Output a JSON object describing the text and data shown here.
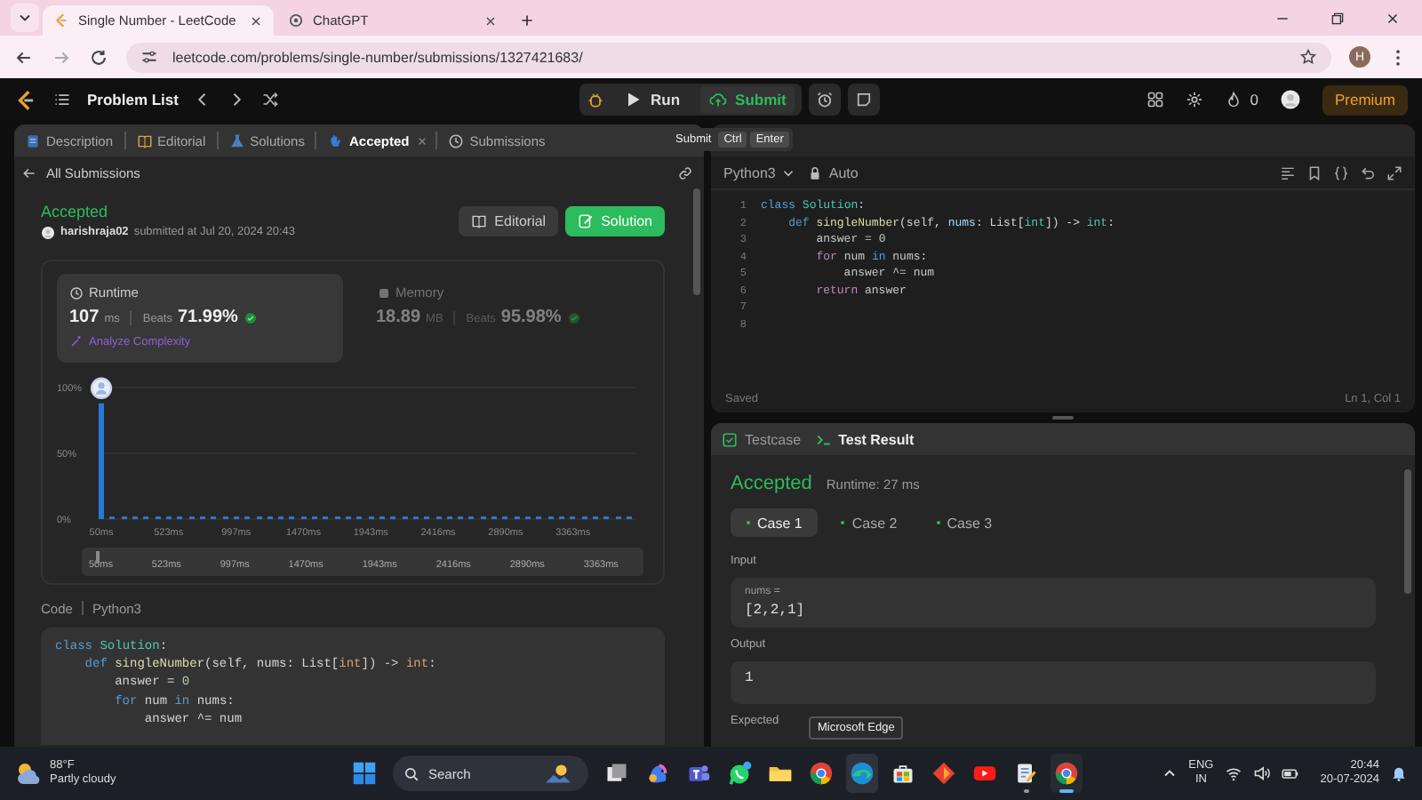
{
  "browser": {
    "tabs": [
      {
        "title": "Single Number - LeetCode",
        "selected": true
      },
      {
        "title": "ChatGPT",
        "selected": false
      }
    ],
    "url": "leetcode.com/problems/single-number/submissions/1327421683/",
    "profile_initial": "H"
  },
  "nav": {
    "problem_list": "Problem List",
    "run": "Run",
    "submit": "Submit",
    "streak": "0",
    "premium": "Premium"
  },
  "submit_tooltip": {
    "label": "Submit",
    "keys": [
      "Ctrl",
      "Enter"
    ]
  },
  "left_tabs": [
    {
      "label": "Description",
      "selected": false,
      "closable": false
    },
    {
      "label": "Editorial",
      "selected": false,
      "closable": false
    },
    {
      "label": "Solutions",
      "selected": false,
      "closable": false
    },
    {
      "label": "Accepted",
      "selected": true,
      "closable": true
    },
    {
      "label": "Submissions",
      "selected": false,
      "closable": false
    }
  ],
  "back_link": "All Submissions",
  "submission": {
    "status": "Accepted",
    "user": "harishraja02",
    "submitted": "submitted at Jul 20, 2024 20:43",
    "buttons": [
      {
        "label": "Editorial",
        "kind": "secondary"
      },
      {
        "label": "Solution",
        "kind": "primary"
      }
    ]
  },
  "metrics": [
    {
      "title": "Runtime",
      "value": "107",
      "unit": "ms",
      "beats_label": "Beats",
      "beats": "71.99%",
      "selected": true,
      "link": "Analyze Complexity"
    },
    {
      "title": "Memory",
      "value": "18.89",
      "unit": "MB",
      "beats_label": "Beats",
      "beats": "95.98%",
      "selected": false
    }
  ],
  "distribution": {
    "chart_data": {
      "type": "bar",
      "ylim": [
        0,
        100
      ],
      "xlim": [
        50,
        3758
      ],
      "yticks": [
        {
          "value": 0,
          "label": "0%"
        },
        {
          "value": 50,
          "label": "50%"
        },
        {
          "value": 100,
          "label": "100%"
        }
      ],
      "xticks": [
        {
          "value": 50,
          "label": "50ms"
        },
        {
          "value": 523,
          "label": "523ms"
        },
        {
          "value": 997,
          "label": "997ms"
        },
        {
          "value": 1470,
          "label": "1470ms"
        },
        {
          "value": 1943,
          "label": "1943ms"
        },
        {
          "value": 2416,
          "label": "2416ms"
        },
        {
          "value": 2890,
          "label": "2890ms"
        },
        {
          "value": 3363,
          "label": "3363ms"
        }
      ],
      "x": [
        50,
        129,
        208,
        287,
        366,
        445,
        523,
        602,
        681,
        760,
        839,
        918,
        997,
        1076,
        1155,
        1234,
        1312,
        1391,
        1470,
        1549,
        1628,
        1707,
        1786,
        1865,
        1943,
        2022,
        2101,
        2180,
        2259,
        2338,
        2416,
        2495,
        2574,
        2653,
        2732,
        2811,
        2890,
        2969,
        3048,
        3127,
        3206,
        3285,
        3363,
        3442,
        3521,
        3600,
        3679,
        3758
      ],
      "values": [
        88,
        2,
        2,
        2,
        2,
        2,
        2,
        2,
        2,
        2,
        2,
        2,
        2,
        2,
        2,
        2,
        2,
        2,
        2,
        2,
        2,
        2,
        2,
        2,
        2,
        2,
        2,
        2,
        2,
        2,
        2,
        2,
        2,
        2,
        2,
        2,
        2,
        2,
        2,
        2,
        2,
        2,
        2,
        2,
        2,
        2,
        2,
        2
      ]
    },
    "navigator_labels": [
      "50ms",
      "523ms",
      "997ms",
      "1470ms",
      "1943ms",
      "2416ms",
      "2890ms",
      "3363ms"
    ]
  },
  "code_view": {
    "label": "Code",
    "language": "Python3",
    "lines": [
      {
        "segments": [
          {
            "text": "class",
            "kind": "keyword"
          },
          {
            "text": " Solution",
            "kind": "class"
          },
          {
            "text": ":",
            "kind": "plain"
          }
        ]
      },
      {
        "segments": [
          {
            "text": "    def",
            "kind": "keyword"
          },
          {
            "text": " singleNumber",
            "kind": "function"
          },
          {
            "text": "(self, nums: List[",
            "kind": "plain"
          },
          {
            "text": "int",
            "kind": "type"
          },
          {
            "text": "]) -> ",
            "kind": "plain"
          },
          {
            "text": "int",
            "kind": "type"
          },
          {
            "text": ":",
            "kind": "plain"
          }
        ]
      },
      {
        "segments": [
          {
            "text": "        answer = ",
            "kind": "plain"
          },
          {
            "text": "0",
            "kind": "number"
          }
        ]
      },
      {
        "segments": [
          {
            "text": "        for",
            "kind": "keyword"
          },
          {
            "text": " num ",
            "kind": "plain"
          },
          {
            "text": "in",
            "kind": "keyword"
          },
          {
            "text": " nums:",
            "kind": "plain"
          }
        ]
      },
      {
        "segments": [
          {
            "text": "            answer ^= num",
            "kind": "plain"
          }
        ]
      }
    ]
  },
  "editor": {
    "language": "Python3",
    "mode": "Auto",
    "status": "Saved",
    "cursor": "Ln 1, Col 1",
    "lines": [
      {
        "number": "1",
        "segments": [
          {
            "text": "class",
            "kind": "keyword"
          },
          {
            "text": " Solution",
            "kind": "class"
          },
          {
            "text": ":",
            "kind": "plain"
          }
        ]
      },
      {
        "number": "2",
        "segments": [
          {
            "text": "    def",
            "kind": "keyword"
          },
          {
            "text": " singleNumber",
            "kind": "function"
          },
          {
            "text": "(self, ",
            "kind": "plain"
          },
          {
            "text": "nums",
            "kind": "param"
          },
          {
            "text": ": List[",
            "kind": "plain"
          },
          {
            "text": "int",
            "kind": "type"
          },
          {
            "text": "]) -> ",
            "kind": "plain"
          },
          {
            "text": "int",
            "kind": "type"
          },
          {
            "text": ":",
            "kind": "plain"
          }
        ]
      },
      {
        "number": "3",
        "segments": [
          {
            "text": "        answer",
            "kind": "variable"
          },
          {
            "text": " = ",
            "kind": "plain"
          },
          {
            "text": "0",
            "kind": "number"
          }
        ]
      },
      {
        "number": "4",
        "segments": [
          {
            "text": "        for",
            "kind": "control"
          },
          {
            "text": " num ",
            "kind": "variable"
          },
          {
            "text": "in",
            "kind": "keyword"
          },
          {
            "text": " nums",
            "kind": "variable"
          },
          {
            "text": ":",
            "kind": "plain"
          }
        ]
      },
      {
        "number": "5",
        "segments": [
          {
            "text": "            answer",
            "kind": "variable"
          },
          {
            "text": " ^= ",
            "kind": "plain"
          },
          {
            "text": "num",
            "kind": "variable"
          }
        ]
      },
      {
        "number": "6",
        "segments": [
          {
            "text": "        return",
            "kind": "control"
          },
          {
            "text": " answer",
            "kind": "variable"
          }
        ]
      },
      {
        "number": "7"
      },
      {
        "number": "8"
      }
    ]
  },
  "console": {
    "tabs": [
      {
        "label": "Testcase",
        "selected": false
      },
      {
        "label": "Test Result",
        "selected": true
      }
    ],
    "status": "Accepted",
    "runtime": "Runtime: 27 ms",
    "cases": [
      {
        "label": "Case 1",
        "selected": true
      },
      {
        "label": "Case 2",
        "selected": false
      },
      {
        "label": "Case 3",
        "selected": false
      }
    ],
    "sections": [
      {
        "label": "Input",
        "variable": "nums =",
        "value": "[2,2,1]"
      },
      {
        "label": "Output",
        "value": "1"
      },
      {
        "label": "Expected"
      }
    ]
  },
  "hover_tooltip": "Microsoft Edge",
  "taskbar": {
    "weather_temp": "88°F",
    "weather_text": "Partly cloudy",
    "search": "Search",
    "apps": [
      {
        "kind": "taskview",
        "open": false,
        "active": false,
        "hovered": false
      },
      {
        "kind": "copilot",
        "open": false,
        "active": false,
        "hovered": false
      },
      {
        "kind": "teams",
        "open": false,
        "active": false,
        "hovered": false
      },
      {
        "kind": "whatsapp",
        "open": false,
        "active": false,
        "hovered": false
      },
      {
        "kind": "files",
        "open": false,
        "active": false,
        "hovered": false
      },
      {
        "kind": "chrome",
        "open": false,
        "active": false,
        "hovered": false
      },
      {
        "kind": "edge",
        "open": false,
        "active": false,
        "hovered": true
      },
      {
        "kind": "store",
        "open": false,
        "active": false,
        "hovered": false
      },
      {
        "kind": "app",
        "open": false,
        "active": false,
        "hovered": false
      },
      {
        "kind": "youtube",
        "open": false,
        "active": false,
        "hovered": false
      },
      {
        "kind": "notepad",
        "open": true,
        "active": false,
        "hovered": false
      },
      {
        "kind": "chrome",
        "open": true,
        "active": true,
        "hovered": false
      }
    ],
    "lang": "ENG",
    "region": "IN",
    "time": "20:44",
    "date": "20-07-2024"
  }
}
